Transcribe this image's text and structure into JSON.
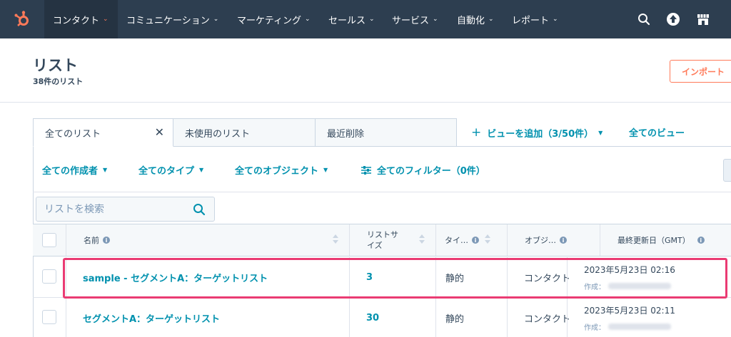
{
  "nav": {
    "items": [
      {
        "label": "コンタクト",
        "active": true
      },
      {
        "label": "コミュニケーション"
      },
      {
        "label": "マーケティング"
      },
      {
        "label": "セールス"
      },
      {
        "label": "サービス"
      },
      {
        "label": "自動化"
      },
      {
        "label": "レポート"
      }
    ],
    "icons": [
      "search-icon",
      "upgrade-icon",
      "marketplace-icon"
    ],
    "accent_color": "#ff7a59",
    "bg_color": "#2d3e50"
  },
  "header": {
    "title": "リスト",
    "count": "38件のリスト",
    "import_label": "インポート"
  },
  "views": {
    "tabs": [
      {
        "label": "全てのリスト",
        "active": true
      },
      {
        "label": "未使用のリスト"
      },
      {
        "label": "最近削除"
      }
    ],
    "add_view": "ビューを追加（3/50件）",
    "all_views": "全てのビュー"
  },
  "filters": {
    "creator": "全ての作成者",
    "type": "全てのタイプ",
    "object": "全てのオブジェクト",
    "all_filters": "全てのフィルター（0件）"
  },
  "search": {
    "placeholder": "リストを検索"
  },
  "table": {
    "headers": {
      "name": "名前",
      "size_line1": "リストサ",
      "size_line2": "イズ",
      "type": "タイ…",
      "object": "オブジ…",
      "updated": "最終更新日（GMT）"
    },
    "rows": [
      {
        "name": "sample - セグメントA：ターゲットリスト",
        "size": "3",
        "type": "静的",
        "object": "コンタクト",
        "updated": "2023年5月23日 02:16",
        "creator_label": "作成："
      },
      {
        "name": "セグメントA：ターゲットリスト",
        "size": "30",
        "type": "静的",
        "object": "コンタクト",
        "updated": "2023年5月23日 02:11",
        "creator_label": "作成："
      }
    ]
  },
  "highlight_color": "#ea3b73"
}
